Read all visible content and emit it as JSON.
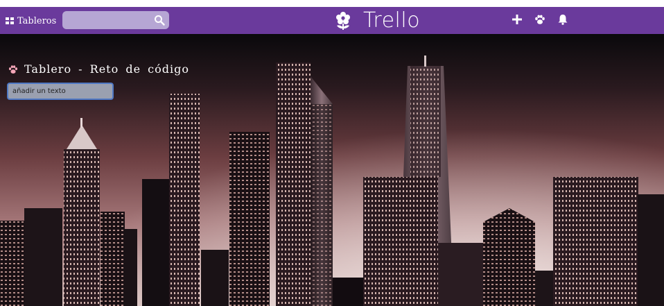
{
  "navbar": {
    "boards_label": "Tableros",
    "search_placeholder": "",
    "brand_text": "Trello",
    "icons": [
      "grid-icon",
      "search-icon",
      "flower-logo-icon",
      "plus-icon",
      "paw-icon",
      "bell-icon"
    ]
  },
  "board": {
    "title": "Tablero - Reto de código",
    "input_value": "añadir un texto",
    "input_placeholder": "añadir un texto"
  },
  "colors": {
    "navbar": "#6a3a9c",
    "search_bg": "#b6a6d4",
    "paw_accent": "#f4a6b8",
    "input_border": "#4f78c4"
  }
}
